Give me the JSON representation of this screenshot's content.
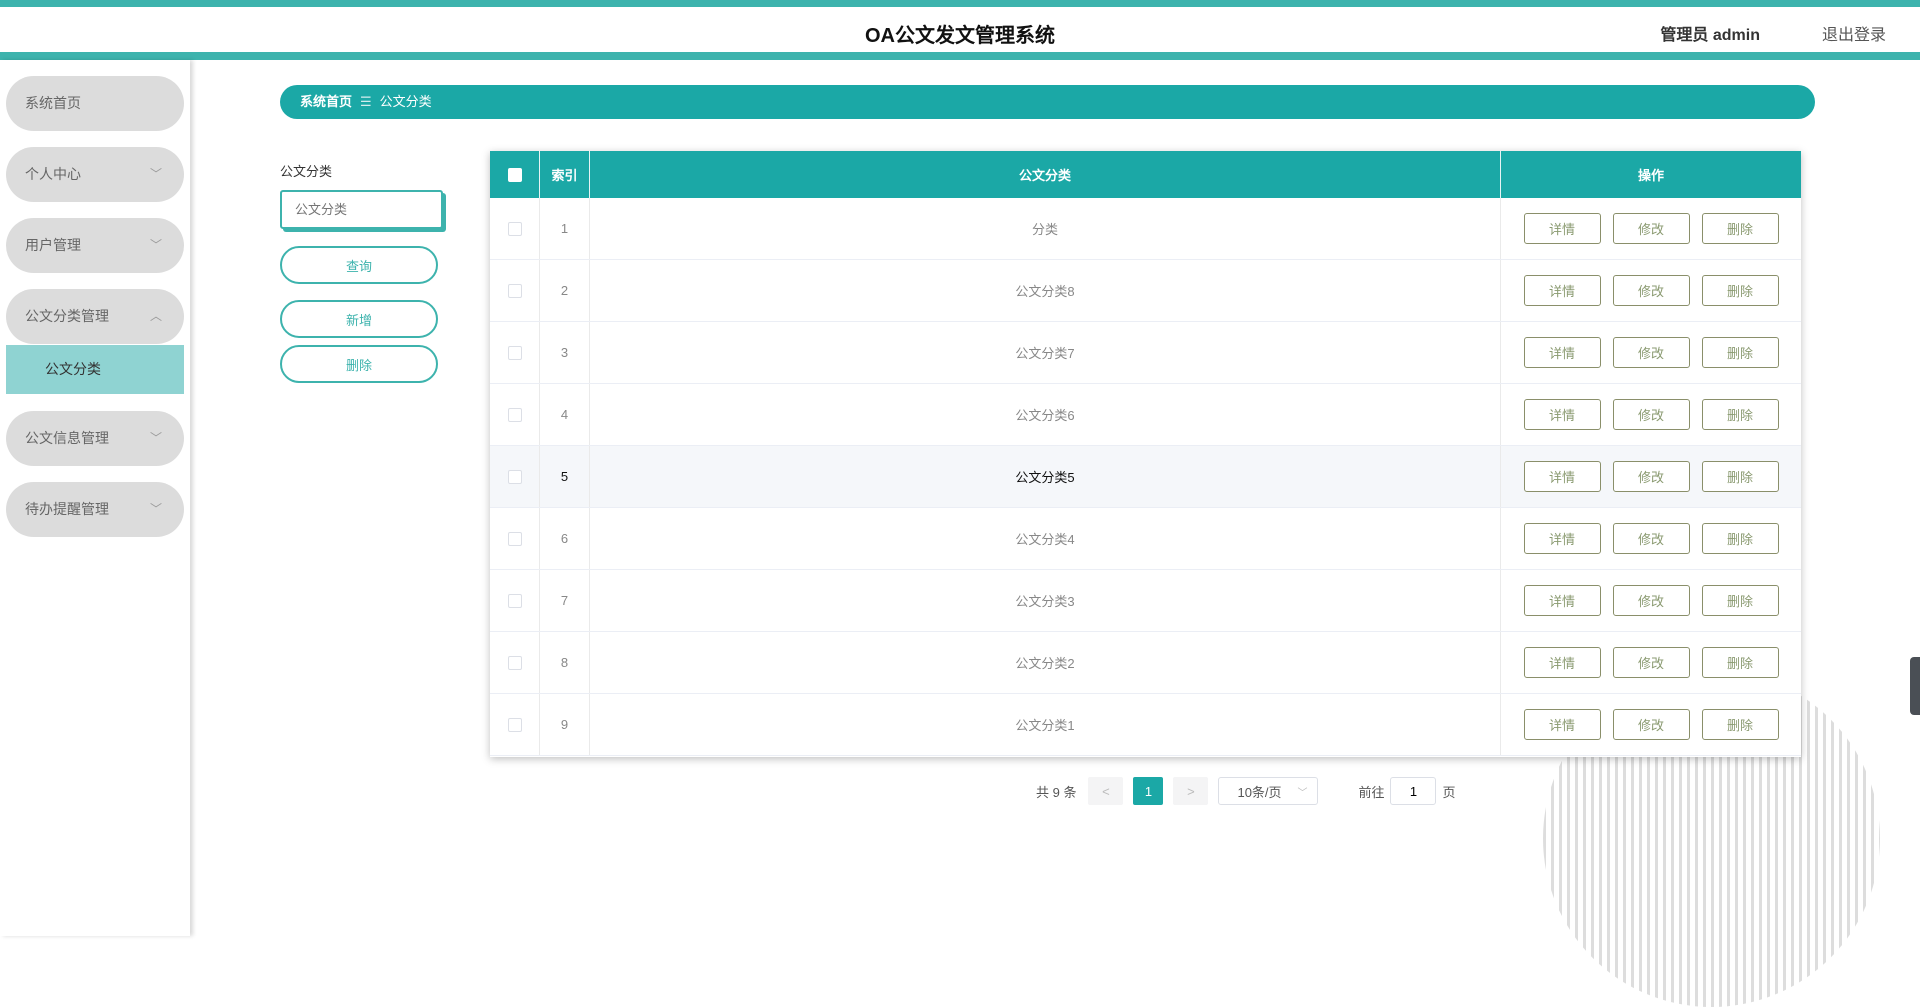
{
  "header": {
    "title": "OA公文发文管理系统",
    "user": "管理员 admin",
    "logout": "退出登录"
  },
  "sidebar": {
    "items": [
      {
        "label": "系统首页"
      },
      {
        "label": "个人中心"
      },
      {
        "label": "用户管理"
      },
      {
        "label": "公文分类管理"
      },
      {
        "label": "公文信息管理"
      },
      {
        "label": "待办提醒管理"
      }
    ],
    "sub": "公文分类"
  },
  "breadcrumb": {
    "home": "系统首页",
    "sep": "☰",
    "current": "公文分类"
  },
  "search": {
    "label": "公文分类",
    "placeholder": "公文分类",
    "query": "查询",
    "add": "新增",
    "delete": "删除"
  },
  "table": {
    "headers": [
      "",
      "索引",
      "公文分类",
      "操作"
    ],
    "rows": [
      [
        "1",
        "分类"
      ],
      [
        "2",
        "公文分类8"
      ],
      [
        "3",
        "公文分类7"
      ],
      [
        "4",
        "公文分类6"
      ],
      [
        "5",
        "公文分类5"
      ],
      [
        "6",
        "公文分类4"
      ],
      [
        "7",
        "公文分类3"
      ],
      [
        "8",
        "公文分类2"
      ],
      [
        "9",
        "公文分类1"
      ]
    ],
    "actions": [
      "详情",
      "修改",
      "删除"
    ]
  },
  "pagination": {
    "total": "共 9 条",
    "prev": "<",
    "page": "1",
    "next": ">",
    "size": "10条/页",
    "goto": "前往",
    "goto_value": "1",
    "page_unit": "页"
  }
}
